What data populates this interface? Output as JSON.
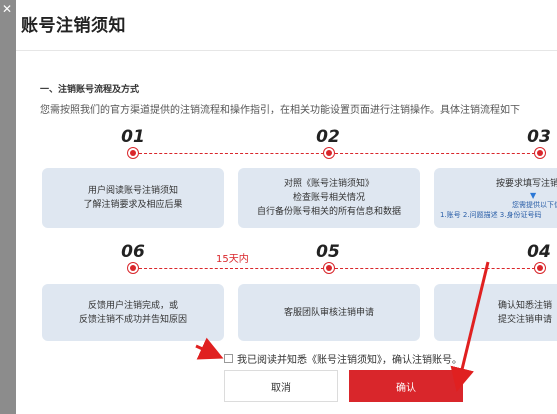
{
  "overlay": {
    "close_glyph": "✕"
  },
  "dialog": {
    "title": "账号注销须知",
    "section_title": "一、注销账号流程及方式",
    "description": "您需按照我们的官方渠道提供的注销流程和操作指引，在相关功能设置页面进行注销操作。具体注销流程如下",
    "steps_top": [
      {
        "num": "01",
        "lines": [
          "用户阅读账号注销须知",
          "了解注销要求及相应后果"
        ]
      },
      {
        "num": "02",
        "lines": [
          "对照《账号注销须知》",
          "检查账号相关情况",
          "自行备份账号相关的所有信息和数据"
        ]
      },
      {
        "num": "03",
        "lines": [
          "按要求填写注销",
          "▼",
          "您需提供以下信",
          "1.账号 2.问题描述 3.身份证号码"
        ]
      }
    ],
    "steps_bottom": [
      {
        "num": "06",
        "lines": [
          "反馈用户注销完成，或",
          "反馈注销不成功并告知原因"
        ]
      },
      {
        "num": "05",
        "lines": [
          "客服团队审核注销申请"
        ]
      },
      {
        "num": "04",
        "lines": [
          "确认知悉注销",
          "提交注销申请"
        ]
      }
    ],
    "note_15days": "15天内",
    "agreement": "我已阅读并知悉《账号注销须知》，确认注销账号。",
    "cancel_label": "取消",
    "confirm_label": "确认",
    "accent_color": "#d9262b",
    "box_color": "#dfe7f1"
  }
}
